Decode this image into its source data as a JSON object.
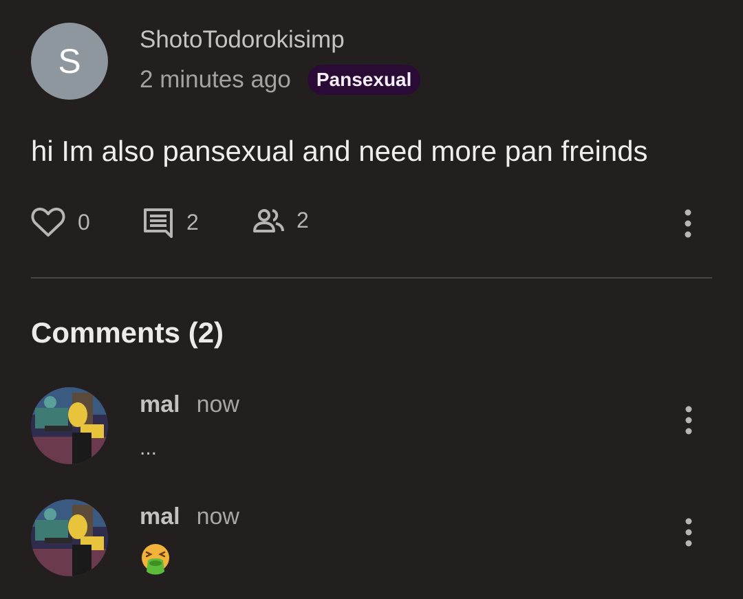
{
  "post": {
    "author_initial": "S",
    "author_name": "ShotoTodorokisimp",
    "timestamp": "2 minutes ago",
    "badge": "Pansexual",
    "body": "hi Im also pansexual and need more pan freinds",
    "likes": "0",
    "comments_count": "2",
    "participants": "2"
  },
  "comments_section": {
    "title": "Comments (2)",
    "items": [
      {
        "author": "mal",
        "time": "now",
        "text": "..."
      },
      {
        "author": "mal",
        "time": "now",
        "emoji": "face-vomiting-emoji"
      }
    ]
  },
  "icons": {
    "like": "heart-outline-icon",
    "comments": "comment-icon",
    "participants": "group-icon",
    "more": "more-vertical-icon"
  },
  "colors": {
    "background": "#231f1f",
    "badge_bg": "#2a0b35",
    "avatar_bg": "#8d979d",
    "divider": "#4a4444"
  }
}
